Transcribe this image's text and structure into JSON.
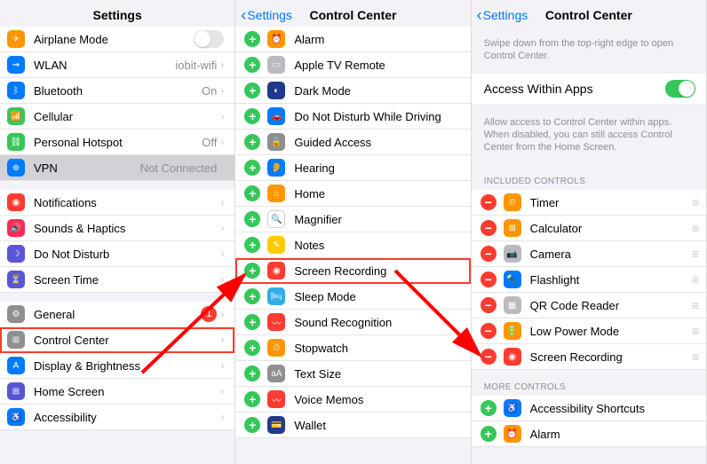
{
  "panel1": {
    "title": "Settings",
    "groups": [
      [
        {
          "label": "Airplane Mode",
          "iconColor": "bg-orange",
          "glyph": "✈",
          "accessory": "toggle",
          "toggleOn": false
        },
        {
          "label": "WLAN",
          "iconColor": "bg-blue",
          "glyph": "⇝",
          "detail": "iobit-wifi",
          "accessory": "chevron"
        },
        {
          "label": "Bluetooth",
          "iconColor": "bg-blue",
          "glyph": "ᛒ",
          "detail": "On",
          "accessory": "chevron"
        },
        {
          "label": "Cellular",
          "iconColor": "bg-green",
          "glyph": "📶",
          "accessory": "chevron"
        },
        {
          "label": "Personal Hotspot",
          "iconColor": "bg-green",
          "glyph": "⛓",
          "detail": "Off",
          "accessory": "chevron"
        },
        {
          "label": "VPN",
          "iconColor": "bg-blue",
          "glyph": "⊕",
          "detail": "Not Connected",
          "accessory": "chevron",
          "selected": true
        }
      ],
      [
        {
          "label": "Notifications",
          "iconColor": "bg-red",
          "glyph": "◉",
          "accessory": "chevron"
        },
        {
          "label": "Sounds & Haptics",
          "iconColor": "bg-pink",
          "glyph": "🔊",
          "accessory": "chevron"
        },
        {
          "label": "Do Not Disturb",
          "iconColor": "bg-purple",
          "glyph": "☽",
          "accessory": "chevron"
        },
        {
          "label": "Screen Time",
          "iconColor": "bg-purple",
          "glyph": "⏳",
          "accessory": "chevron"
        }
      ],
      [
        {
          "label": "General",
          "iconColor": "bg-gray",
          "glyph": "⚙",
          "badge": "1",
          "accessory": "chevron"
        },
        {
          "label": "Control Center",
          "iconColor": "bg-gray",
          "glyph": "⊞",
          "accessory": "chevron",
          "highlighted": true
        },
        {
          "label": "Display & Brightness",
          "iconColor": "bg-blue",
          "glyph": "A",
          "accessory": "chevron"
        },
        {
          "label": "Home Screen",
          "iconColor": "bg-indigo",
          "glyph": "⊞",
          "accessory": "chevron"
        },
        {
          "label": "Accessibility",
          "iconColor": "bg-blue",
          "glyph": "♿",
          "accessory": "chevron"
        }
      ]
    ]
  },
  "panel2": {
    "back": "Settings",
    "title": "Control Center",
    "items": [
      {
        "label": "Alarm",
        "iconColor": "bg-orange",
        "glyph": "⏰"
      },
      {
        "label": "Apple TV Remote",
        "iconColor": "bg-lgray",
        "glyph": "▭"
      },
      {
        "label": "Dark Mode",
        "iconColor": "bg-navy",
        "glyph": "◐"
      },
      {
        "label": "Do Not Disturb While Driving",
        "iconColor": "bg-blue",
        "glyph": "🚗"
      },
      {
        "label": "Guided Access",
        "iconColor": "bg-gray",
        "glyph": "🔒"
      },
      {
        "label": "Hearing",
        "iconColor": "bg-blue",
        "glyph": "👂"
      },
      {
        "label": "Home",
        "iconColor": "bg-orange",
        "glyph": "⌂"
      },
      {
        "label": "Magnifier",
        "iconColor": "bg-white",
        "glyph": "🔍"
      },
      {
        "label": "Notes",
        "iconColor": "bg-yellow",
        "glyph": "✎"
      },
      {
        "label": "Screen Recording",
        "iconColor": "bg-red",
        "glyph": "◉",
        "highlighted": true
      },
      {
        "label": "Sleep Mode",
        "iconColor": "bg-teal",
        "glyph": "🛏"
      },
      {
        "label": "Sound Recognition",
        "iconColor": "bg-red",
        "glyph": "〰"
      },
      {
        "label": "Stopwatch",
        "iconColor": "bg-orange",
        "glyph": "⏱"
      },
      {
        "label": "Text Size",
        "iconColor": "bg-gray",
        "glyph": "aA"
      },
      {
        "label": "Voice Memos",
        "iconColor": "bg-red",
        "glyph": "〰"
      },
      {
        "label": "Wallet",
        "iconColor": "bg-navy",
        "glyph": "💳"
      }
    ]
  },
  "panel3": {
    "back": "Settings",
    "title": "Control Center",
    "topDesc": "Swipe down from the top-right edge to open Control Center.",
    "accessRow": {
      "label": "Access Within Apps",
      "toggleOn": true
    },
    "accessDesc": "Allow access to Control Center within apps. When disabled, you can still access Control Center from the Home Screen.",
    "includedHeader": "INCLUDED CONTROLS",
    "included": [
      {
        "label": "Timer",
        "iconColor": "bg-orange",
        "glyph": "⏲"
      },
      {
        "label": "Calculator",
        "iconColor": "bg-orange",
        "glyph": "⊞"
      },
      {
        "label": "Camera",
        "iconColor": "bg-lgray",
        "glyph": "📷"
      },
      {
        "label": "Flashlight",
        "iconColor": "bg-blue",
        "glyph": "🔦"
      },
      {
        "label": "QR Code Reader",
        "iconColor": "bg-lgray",
        "glyph": "▦"
      },
      {
        "label": "Low Power Mode",
        "iconColor": "bg-orange",
        "glyph": "🔋"
      },
      {
        "label": "Screen Recording",
        "iconColor": "bg-red",
        "glyph": "◉"
      }
    ],
    "moreHeader": "MORE CONTROLS",
    "more": [
      {
        "label": "Accessibility Shortcuts",
        "iconColor": "bg-blue",
        "glyph": "♿"
      },
      {
        "label": "Alarm",
        "iconColor": "bg-orange",
        "glyph": "⏰"
      }
    ]
  }
}
